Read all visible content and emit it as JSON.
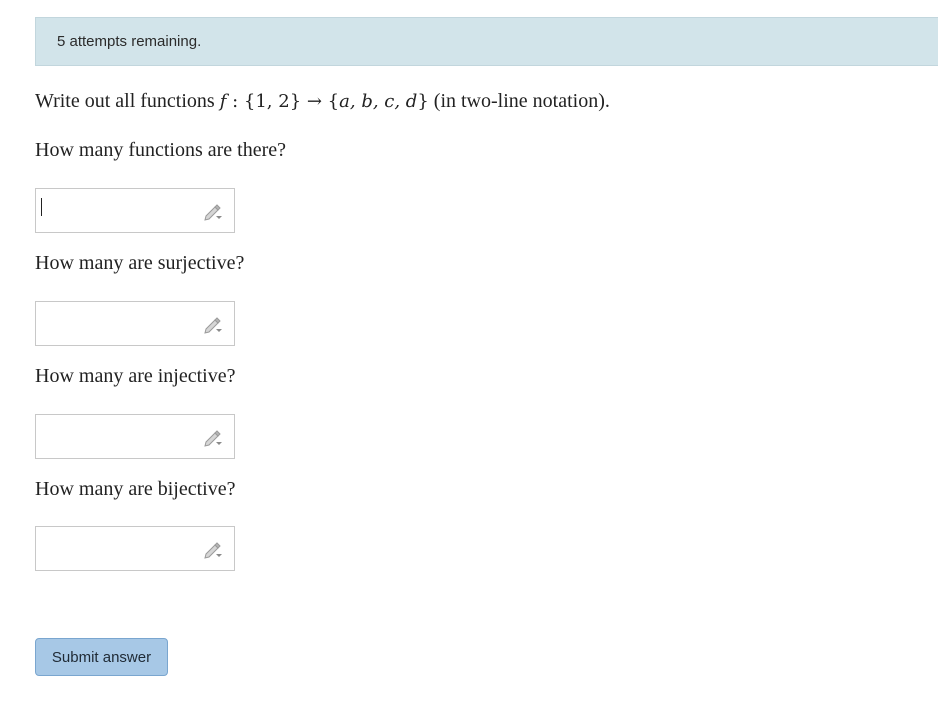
{
  "banner": {
    "attempts_text": "5 attempts remaining."
  },
  "prompt": {
    "lead": "Write out all functions ",
    "math_f": "f",
    "math_mapping": " : {1, 2} → {",
    "math_codomain": "a, b, c, d",
    "math_close": "}",
    "tail": " (in two-line notation)."
  },
  "questions": [
    {
      "label": "How many functions are there?",
      "value": "",
      "focused": true
    },
    {
      "label": "How many are surjective?",
      "value": ""
    },
    {
      "label": "How many are injective?",
      "value": ""
    },
    {
      "label": "How many are bijective?",
      "value": ""
    }
  ],
  "icons": {
    "answer_editor": "pencil-dropdown-icon"
  },
  "submit": {
    "label": "Submit answer"
  },
  "colors": {
    "banner_bg": "#d2e4ea",
    "button_bg": "#a7c8e6"
  }
}
